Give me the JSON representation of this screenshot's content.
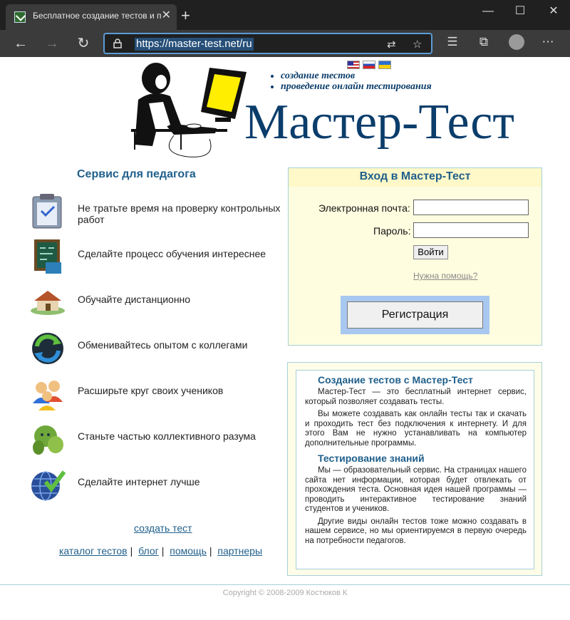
{
  "browser": {
    "tab_title": "Бесплатное создание тестов и проведение онлайн тестирования",
    "url": "https://master-test.net/ru"
  },
  "header": {
    "bullets": [
      "создание тестов",
      "проведение онлайн тестирования"
    ],
    "logo_text": "Мастер-Тест",
    "languages": [
      "en-flag",
      "ru-flag",
      "ua-flag"
    ]
  },
  "left": {
    "title": "Сервис для педагога",
    "features": [
      {
        "icon": "clipboard-check-icon",
        "text": "Не тратьте время на проверку контрольных работ"
      },
      {
        "icon": "chalkboard-icon",
        "text": "Сделайте процесс обучения интереснее"
      },
      {
        "icon": "house-icon",
        "text": "Обучайте дистанционно"
      },
      {
        "icon": "exchange-arrows-icon",
        "text": "Обменивайтесь опытом с коллегами"
      },
      {
        "icon": "people-group-icon",
        "text": "Расширьте круг своих учеников"
      },
      {
        "icon": "green-blobs-icon",
        "text": "Станьте частью коллективного разума"
      },
      {
        "icon": "globe-check-icon",
        "text": "Сделайте интернет лучше"
      }
    ],
    "create_link": "создать тест",
    "bottom_links": [
      "каталог тестов",
      "блог",
      "помощь",
      "партнеры"
    ]
  },
  "login": {
    "title": "Вход в Мастер-Тест",
    "email_label": "Электронная почта:",
    "password_label": "Пароль:",
    "email_value": "",
    "password_value": "",
    "login_button": "Войти",
    "help_link": "Нужна помощь?",
    "register_button": "Регистрация"
  },
  "info": {
    "heading1": "Создание тестов с Мастер-Тест",
    "p1": "Мастер-Тест — это бесплатный интернет сервис, который позволяет создавать тесты.",
    "p2": "Вы можете создавать как онлайн тесты так и скачать и проходить тест без подключения к интернету. И для этого Вам не нужно устанавливать на компьютер дополнительные программы.",
    "heading2": "Тестирование знаний",
    "p3": "Мы — образовательный сервис. На страницах нашего сайта нет информации, которая будет отвлекать от прохождения теста. Основная идея нашей программы — проводить интерактивное тестирование знаний студентов и учеников.",
    "p4": "Другие виды онлайн тестов тоже можно создавать в нашем сервисе, но мы ориентируемся в первую очередь на потребности педагогов."
  },
  "footer": {
    "copyright": "Copyright © 2008-2009 Костюков К"
  },
  "colors": {
    "accent": "#1f5f8b",
    "logo": "#0b3d6b",
    "login_bg": "#fffde0",
    "register_bg": "#a8c8f0"
  }
}
